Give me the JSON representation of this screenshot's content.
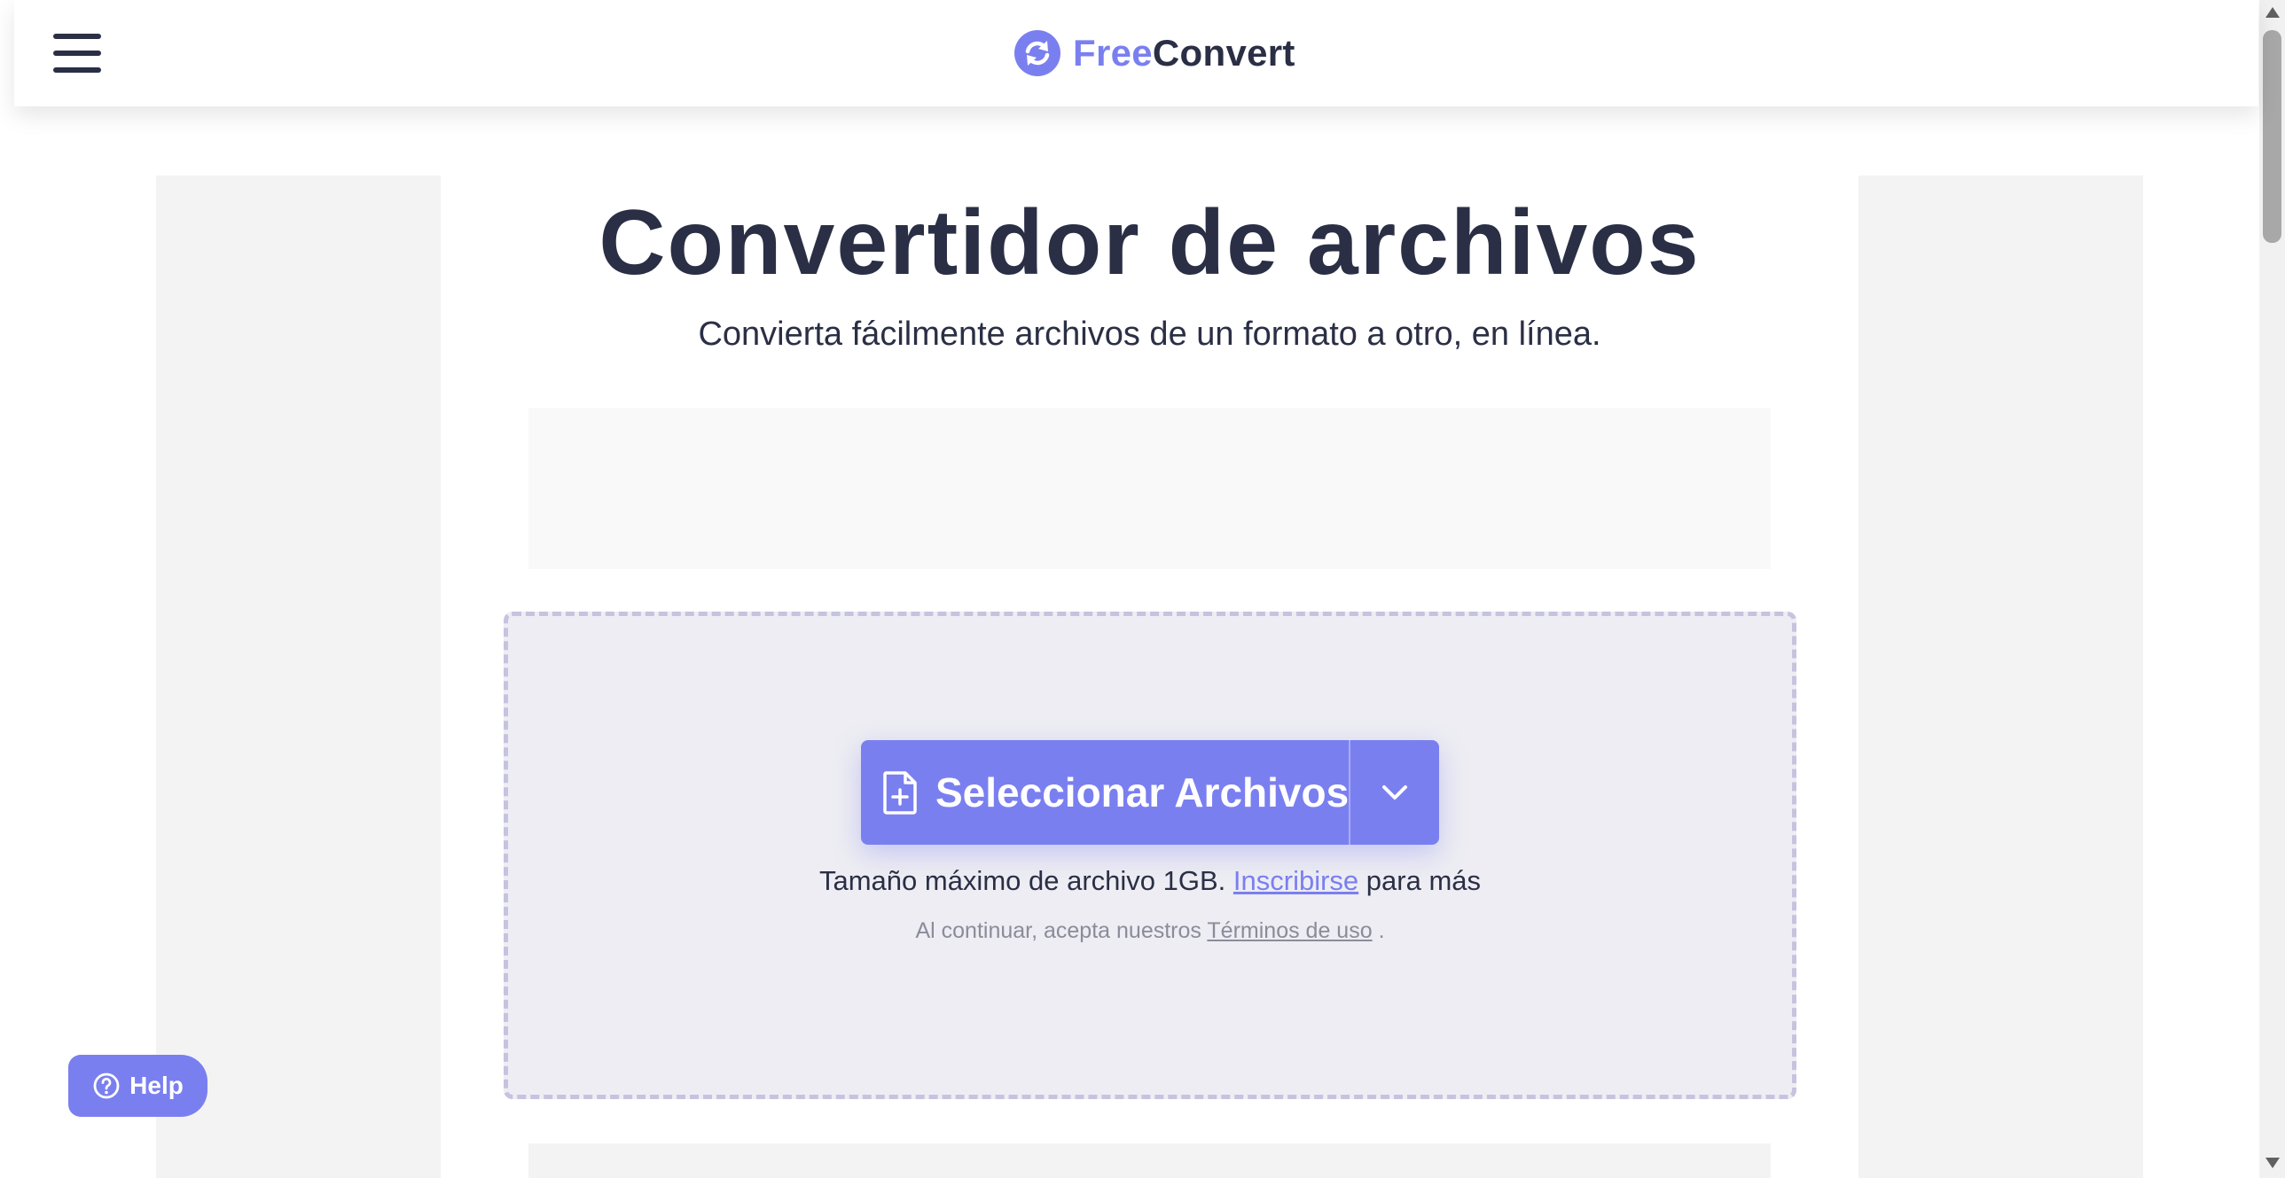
{
  "header": {
    "logo_free": "Free",
    "logo_convert": "Convert",
    "menu_icon": "hamburger-menu-icon",
    "logo_icon": "refresh-circle-icon"
  },
  "main": {
    "title": "Convertidor de archivos",
    "subtitle": "Convierta fácilmente archivos de un formato a otro, en línea.",
    "select_button_label": "Seleccionar Archivos",
    "select_button_icon": "file-plus-icon",
    "dropdown_icon": "chevron-down-icon",
    "size_note_prefix": "Tamaño máximo de archivo 1GB.",
    "size_note_link": "Inscribirse",
    "size_note_suffix": "para más",
    "terms_prefix": "Al continuar, acepta nuestros",
    "terms_link": "Términos de uso",
    "terms_suffix": "."
  },
  "help": {
    "label": "Help",
    "icon": "question-circle-icon"
  },
  "colors": {
    "accent": "#7a7ff0",
    "text_dark": "#2a2f45",
    "dropzone_bg": "#ededf3",
    "dropzone_border": "#c6c3e0"
  }
}
